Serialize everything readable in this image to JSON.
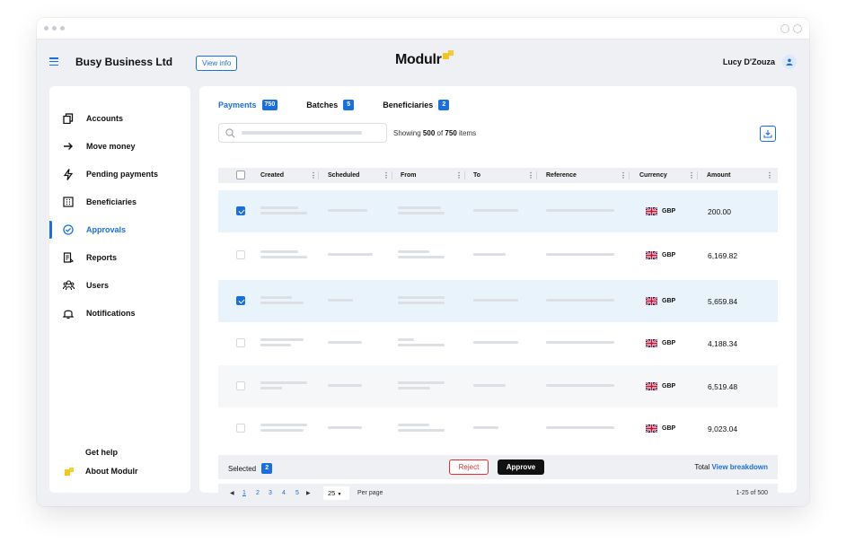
{
  "header": {
    "company": "Busy Business Ltd",
    "view_info": "View info",
    "logo": "Modulr",
    "user": "Lucy D'Zouza"
  },
  "sidebar": {
    "items": [
      {
        "label": "Accounts",
        "icon": "copy-icon"
      },
      {
        "label": "Move money",
        "icon": "arrow-right-icon"
      },
      {
        "label": "Pending payments",
        "icon": "lightning-icon"
      },
      {
        "label": "Beneficiaries",
        "icon": "building-icon"
      },
      {
        "label": "Approvals",
        "icon": "check-circle-icon",
        "active": true
      },
      {
        "label": "Reports",
        "icon": "report-icon"
      },
      {
        "label": "Users",
        "icon": "users-icon"
      },
      {
        "label": "Notifications",
        "icon": "bell-icon"
      }
    ],
    "help": "Get help",
    "about": "About Modulr"
  },
  "tabs": [
    {
      "label": "Payments",
      "count": "750",
      "active": true
    },
    {
      "label": "Batches",
      "count": "5"
    },
    {
      "label": "Beneficiaries",
      "count": "2"
    }
  ],
  "toolbar": {
    "showing_prefix": "Showing",
    "showing_count": "500",
    "showing_of": "of",
    "showing_total": "750",
    "showing_suffix": "items"
  },
  "table": {
    "columns": [
      "Created",
      "Scheduled",
      "From",
      "To",
      "Reference",
      "Currency",
      "Amount"
    ],
    "rows": [
      {
        "checked": true,
        "currency": "GBP",
        "amount": "200.00"
      },
      {
        "checked": false,
        "currency": "GBP",
        "amount": "6,169.82"
      },
      {
        "checked": true,
        "currency": "GBP",
        "amount": "5,659.84"
      },
      {
        "checked": false,
        "currency": "GBP",
        "amount": "4,188.34"
      },
      {
        "checked": false,
        "currency": "GBP",
        "amount": "6,519.48"
      },
      {
        "checked": false,
        "currency": "GBP",
        "amount": "9,023.04"
      }
    ]
  },
  "footer": {
    "selected_label": "Selected",
    "selected_count": "2",
    "reject": "Reject",
    "approve": "Approve",
    "total_label": "Total",
    "breakdown": "View breakdown"
  },
  "pagination": {
    "pages": [
      "1",
      "2",
      "3",
      "4",
      "5"
    ],
    "current": "1",
    "per_page": "25",
    "per_page_label": "Per page",
    "range": "1-25 of 500"
  },
  "colors": {
    "accent": "#1a6fe0",
    "brand_yellow": "#f5c518",
    "danger": "#e03131",
    "selected_row": "#e8f3fc"
  }
}
